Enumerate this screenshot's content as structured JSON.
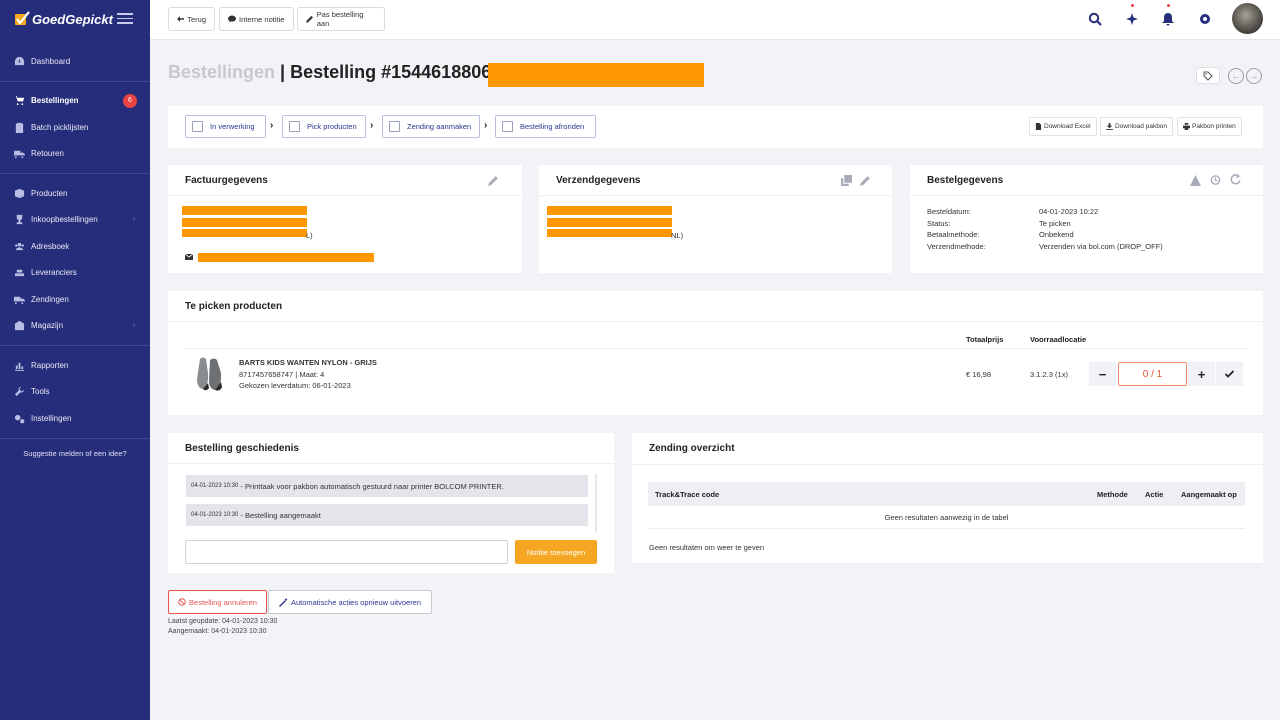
{
  "app": {
    "brand": "GoedGepickt"
  },
  "sidebar": {
    "items": [
      {
        "label": "Dashboard",
        "icon": "dashboard-icon"
      },
      {
        "label": "Bestellingen",
        "icon": "cart-icon",
        "badge": "6"
      },
      {
        "label": "Batch picklijsten",
        "icon": "clipboard-icon"
      },
      {
        "label": "Retouren",
        "icon": "return-truck-icon"
      },
      {
        "label": "Producten",
        "icon": "box-icon"
      },
      {
        "label": "Inkoopbestellingen",
        "icon": "trophy-icon"
      },
      {
        "label": "Adresboek",
        "icon": "users-icon"
      },
      {
        "label": "Leveranciers",
        "icon": "supplier-icon"
      },
      {
        "label": "Zendingen",
        "icon": "truck-icon"
      },
      {
        "label": "Magazijn",
        "icon": "warehouse-icon"
      },
      {
        "label": "Rapporten",
        "icon": "chart-icon"
      },
      {
        "label": "Tools",
        "icon": "wrench-icon"
      },
      {
        "label": "Instellingen",
        "icon": "cogs-icon"
      }
    ],
    "suggestion": "Suggestie melden of een idee?"
  },
  "toolbar": {
    "back": "Terug",
    "internal_note": "Interne notitie",
    "edit_order": "Pas bestelling aan"
  },
  "header": {
    "crumb": "Bestellingen",
    "title": "Bestelling #1544618806"
  },
  "steps": [
    {
      "label": "In verwerking"
    },
    {
      "label": "Pick producten"
    },
    {
      "label": "Zending aanmaken"
    },
    {
      "label": "Bestelling afronden"
    }
  ],
  "downloads": {
    "excel": "Download Excel",
    "packslip": "Download pakbon",
    "print": "Pakbon printen"
  },
  "billing": {
    "title": "Factuurgegevens",
    "country_suffix_1": "L)"
  },
  "shipping": {
    "title": "Verzendgegevens",
    "country_suffix_1": "NL)"
  },
  "order_details": {
    "title": "Bestelgegevens",
    "rows": [
      {
        "label": "Besteldatum:",
        "value": "04-01-2023 10:22"
      },
      {
        "label": "Status:",
        "value": "Te picken"
      },
      {
        "label": "Betaalmethode:",
        "value": "Onbekend"
      },
      {
        "label": "Verzendmethode:",
        "value": "Verzenden via bol.com (DROP_OFF)"
      }
    ]
  },
  "products": {
    "title": "Te picken producten",
    "col_total": "Totaalprijs",
    "col_location": "Voorraadlocatie",
    "items": [
      {
        "name": "BARTS KIDS WANTEN NYLON - GRIJS",
        "sku_line": "8717457658747 | Maat: 4",
        "delivery": "Gekozen leverdatum: 06-01-2023",
        "price": "€ 16,98",
        "location": "3.1.2.3 (1x)",
        "qty": "0 / 1"
      }
    ]
  },
  "history": {
    "title": "Bestelling geschiedenis",
    "rows": [
      {
        "time": "04-01-2023 10:30",
        "text": "- Printtaak voor pakbon automatisch gestuurd naar printer BOLCOM PRINTER."
      },
      {
        "time": "04-01-2023 10:30",
        "text": "- Bestelling aangemaakt"
      }
    ],
    "add_note": "Notitie toevoegen"
  },
  "shipment": {
    "title": "Zending overzicht",
    "col_code": "Track&Trace code",
    "col_method": "Methode",
    "col_action": "Actie",
    "col_created": "Aangemaakt op",
    "empty_table": "Geen resultaten aanwezig in de tabel",
    "empty_footer": "Geen resultaten om weer te geven"
  },
  "footer": {
    "cancel": "Bestelling annuleren",
    "auto_actions": "Automatische acties opnieuw uitvoeren",
    "updated": "Laatst geupdate: 04-01-2023 10:30",
    "created": "Aangemaakt: 04-01-2023 10:30"
  },
  "colors": {
    "sidebar": "#262d7a",
    "accent_orange": "#f5a623",
    "redaction": "#ff9800",
    "danger": "#e65555"
  }
}
